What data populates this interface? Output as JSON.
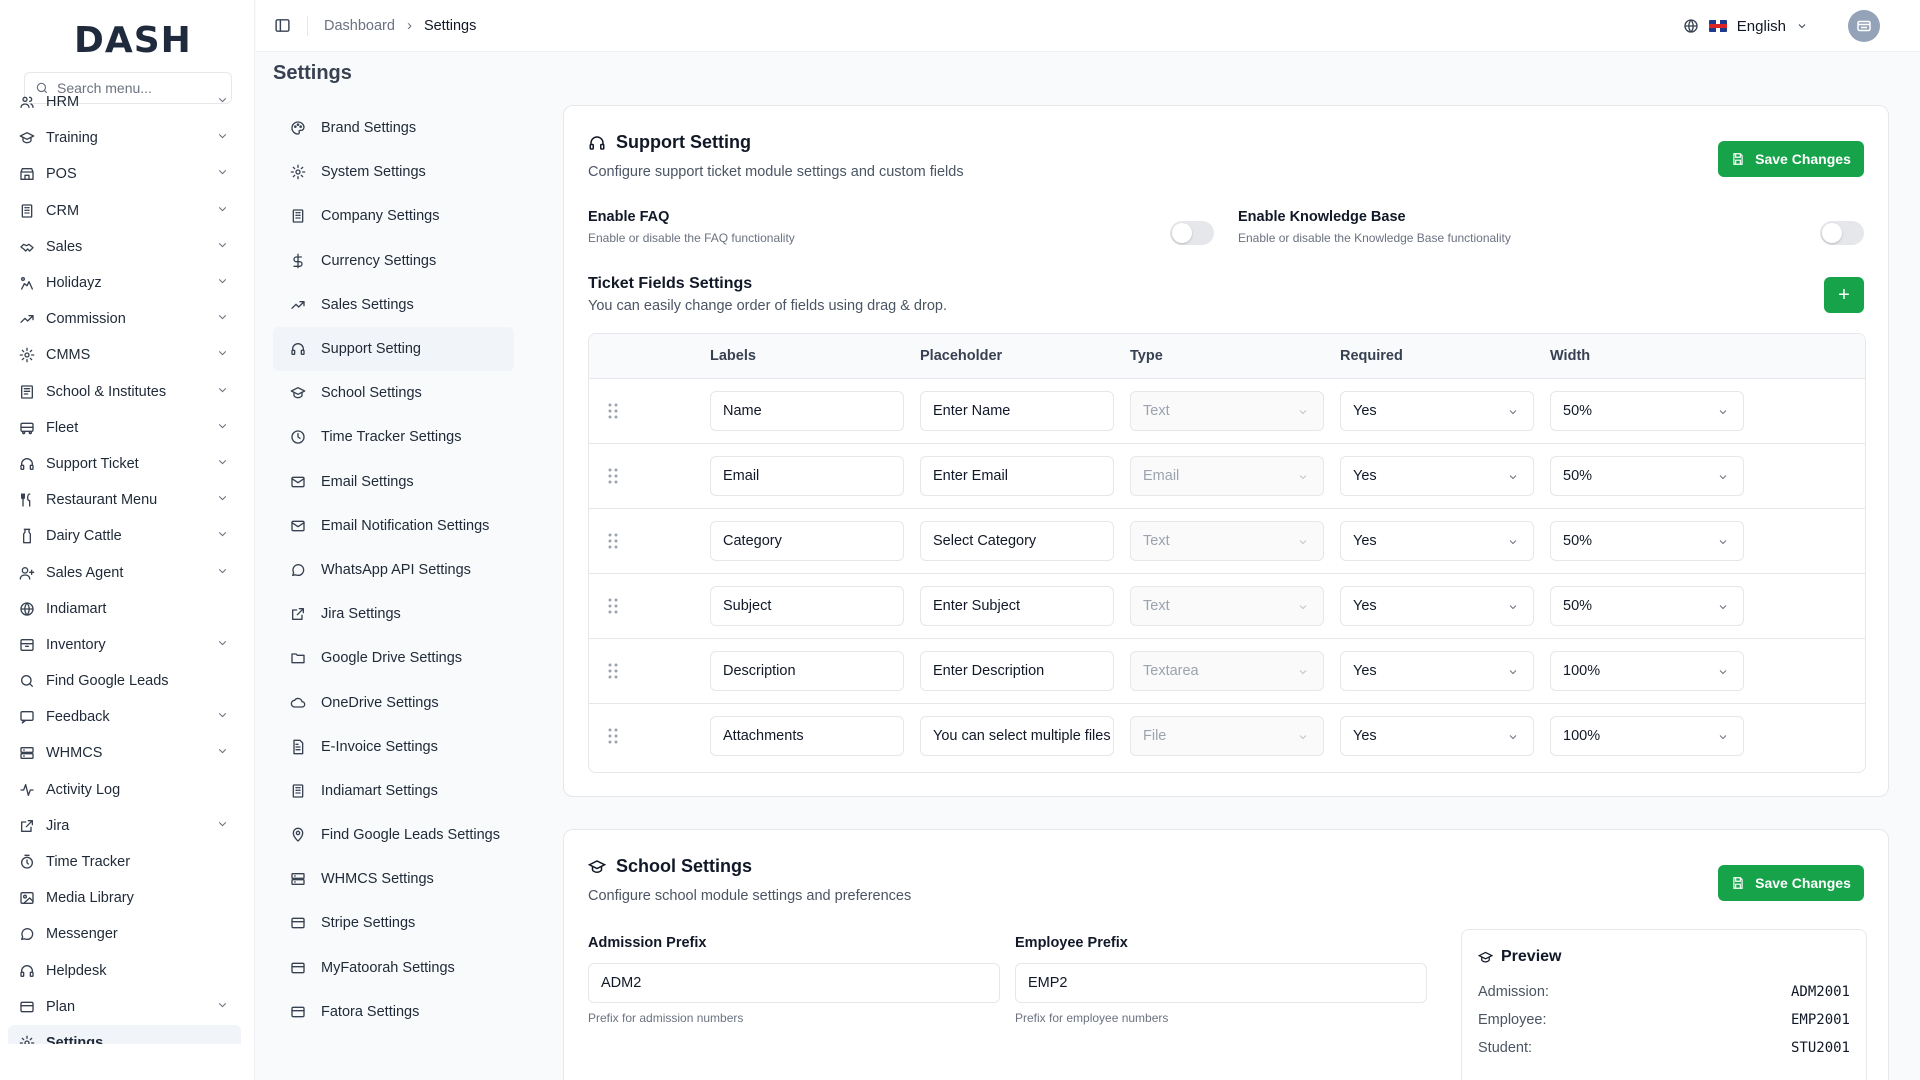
{
  "brand": {
    "logo": "DASH",
    "accent": "#16a34a"
  },
  "search": {
    "placeholder": "Search menu..."
  },
  "sidebar": {
    "items": [
      {
        "label": "HRM",
        "icon": "users-icon",
        "expandable": true
      },
      {
        "label": "Training",
        "icon": "graduation-icon",
        "expandable": true
      },
      {
        "label": "POS",
        "icon": "store-icon",
        "expandable": true
      },
      {
        "label": "CRM",
        "icon": "building-icon",
        "expandable": true
      },
      {
        "label": "Sales",
        "icon": "handshake-icon",
        "expandable": true
      },
      {
        "label": "Holidayz",
        "icon": "holiday-icon",
        "expandable": true
      },
      {
        "label": "Commission",
        "icon": "trend-icon",
        "expandable": true
      },
      {
        "label": "CMMS",
        "icon": "gear-icon",
        "expandable": true
      },
      {
        "label": "School & Institutes",
        "icon": "school-icon",
        "expandable": true
      },
      {
        "label": "Fleet",
        "icon": "bus-icon",
        "expandable": true
      },
      {
        "label": "Support Ticket",
        "icon": "headset-icon",
        "expandable": true
      },
      {
        "label": "Restaurant Menu",
        "icon": "utensils-icon",
        "expandable": true
      },
      {
        "label": "Dairy Cattle",
        "icon": "milk-icon",
        "expandable": true
      },
      {
        "label": "Sales Agent",
        "icon": "user-plus-icon",
        "expandable": true
      },
      {
        "label": "Indiamart",
        "icon": "globe-icon",
        "expandable": false
      },
      {
        "label": "Inventory",
        "icon": "box-icon",
        "expandable": true
      },
      {
        "label": "Find Google Leads",
        "icon": "search-icon",
        "expandable": false
      },
      {
        "label": "Feedback",
        "icon": "message-icon",
        "expandable": true
      },
      {
        "label": "WHMCS",
        "icon": "server-icon",
        "expandable": true
      },
      {
        "label": "Activity Log",
        "icon": "activity-icon",
        "expandable": false
      },
      {
        "label": "Jira",
        "icon": "external-link-icon",
        "expandable": true
      },
      {
        "label": "Time Tracker",
        "icon": "timer-icon",
        "expandable": false
      },
      {
        "label": "Media Library",
        "icon": "image-icon",
        "expandable": false
      },
      {
        "label": "Messenger",
        "icon": "chat-icon",
        "expandable": false
      },
      {
        "label": "Helpdesk",
        "icon": "headset-icon",
        "expandable": false
      },
      {
        "label": "Plan",
        "icon": "card-icon",
        "expandable": true
      },
      {
        "label": "Settings",
        "icon": "gear-icon",
        "expandable": false,
        "active": true
      }
    ]
  },
  "header": {
    "breadcrumb": [
      "Dashboard",
      "Settings"
    ],
    "language": "English"
  },
  "page": {
    "title": "Settings"
  },
  "settings_menu": {
    "items": [
      {
        "label": "Brand Settings",
        "icon": "palette-icon"
      },
      {
        "label": "System Settings",
        "icon": "gear-icon"
      },
      {
        "label": "Company Settings",
        "icon": "building-icon"
      },
      {
        "label": "Currency Settings",
        "icon": "dollar-icon"
      },
      {
        "label": "Sales Settings",
        "icon": "trend-icon"
      },
      {
        "label": "Support Setting",
        "icon": "headset-icon",
        "active": true
      },
      {
        "label": "School Settings",
        "icon": "graduation-icon"
      },
      {
        "label": "Time Tracker Settings",
        "icon": "clock-icon"
      },
      {
        "label": "Email Settings",
        "icon": "mail-icon"
      },
      {
        "label": "Email Notification Settings",
        "icon": "mail-icon"
      },
      {
        "label": "WhatsApp API Settings",
        "icon": "chat-icon"
      },
      {
        "label": "Jira Settings",
        "icon": "external-link-icon"
      },
      {
        "label": "Google Drive Settings",
        "icon": "folder-icon"
      },
      {
        "label": "OneDrive Settings",
        "icon": "cloud-icon"
      },
      {
        "label": "E-Invoice Settings",
        "icon": "file-icon"
      },
      {
        "label": "Indiamart Settings",
        "icon": "building-icon"
      },
      {
        "label": "Find Google Leads Settings",
        "icon": "pin-icon"
      },
      {
        "label": "WHMCS Settings",
        "icon": "server-icon"
      },
      {
        "label": "Stripe Settings",
        "icon": "card-icon"
      },
      {
        "label": "MyFatoorah Settings",
        "icon": "card-icon"
      },
      {
        "label": "Fatora Settings",
        "icon": "card-icon"
      }
    ]
  },
  "support": {
    "title": "Support Setting",
    "subtitle": "Configure support ticket module settings and custom fields",
    "save_label": "Save Changes",
    "faq": {
      "label": "Enable FAQ",
      "desc": "Enable or disable the FAQ functionality",
      "enabled": false
    },
    "kb": {
      "label": "Enable Knowledge Base",
      "desc": "Enable or disable the Knowledge Base functionality",
      "enabled": false
    },
    "fields_title": "Ticket Fields Settings",
    "fields_sub": "You can easily change order of fields using drag & drop.",
    "add_label": "+",
    "columns": [
      "Labels",
      "Placeholder",
      "Type",
      "Required",
      "Width"
    ],
    "rows": [
      {
        "label": "Name",
        "placeholder": "Enter Name",
        "type": "Text",
        "required": "Yes",
        "width": "50%"
      },
      {
        "label": "Email",
        "placeholder": "Enter Email",
        "type": "Email",
        "required": "Yes",
        "width": "50%"
      },
      {
        "label": "Category",
        "placeholder": "Select Category",
        "type": "Text",
        "required": "Yes",
        "width": "50%"
      },
      {
        "label": "Subject",
        "placeholder": "Enter Subject",
        "type": "Text",
        "required": "Yes",
        "width": "50%"
      },
      {
        "label": "Description",
        "placeholder": "Enter Description",
        "type": "Textarea",
        "required": "Yes",
        "width": "100%"
      },
      {
        "label": "Attachments",
        "placeholder": "You can select multiple files",
        "type": "File",
        "required": "Yes",
        "width": "100%"
      }
    ]
  },
  "school": {
    "title": "School Settings",
    "subtitle": "Configure school module settings and preferences",
    "save_label": "Save Changes",
    "admission": {
      "label": "Admission Prefix",
      "value": "ADM2",
      "hint": "Prefix for admission numbers"
    },
    "employee": {
      "label": "Employee Prefix",
      "value": "EMP2",
      "hint": "Prefix for employee numbers"
    },
    "preview": {
      "title": "Preview",
      "rows": [
        {
          "label": "Admission:",
          "value": "ADM2001"
        },
        {
          "label": "Employee:",
          "value": "EMP2001"
        },
        {
          "label": "Student:",
          "value": "STU2001"
        }
      ]
    }
  }
}
